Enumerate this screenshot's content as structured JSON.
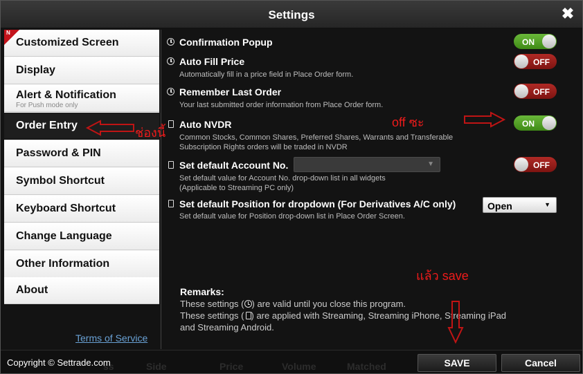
{
  "window": {
    "title": "Settings",
    "close_glyph": "✖"
  },
  "sidebar": {
    "items": [
      {
        "label": "Customized Screen",
        "badge": "N"
      },
      {
        "label": "Display"
      },
      {
        "label": "Alert & Notification",
        "sub": "For Push mode only"
      },
      {
        "label": "Order Entry",
        "active": true
      },
      {
        "label": "Password & PIN"
      },
      {
        "label": "Symbol Shortcut"
      },
      {
        "label": "Keyboard Shortcut"
      },
      {
        "label": "Change Language"
      },
      {
        "label": "Other Information"
      },
      {
        "label": "About"
      }
    ],
    "terms_link": "Terms of Service"
  },
  "settings": [
    {
      "icon": "clock-icon",
      "name": "Confirmation Popup",
      "desc": "",
      "toggle": "ON"
    },
    {
      "icon": "clock-icon",
      "name": "Auto Fill Price",
      "desc": "Automatically fill in a price field in Place Order form.",
      "toggle": "OFF"
    },
    {
      "icon": "clock-icon",
      "name": "Remember Last Order",
      "desc": "Your last submitted order information from Place Order form.",
      "toggle": "OFF"
    },
    {
      "icon": "phone-icon",
      "name": "Auto NVDR",
      "desc": "Common Stocks, Common Shares, Preferred Shares, Warrants and Transferable",
      "desc2": "Subscription Rights orders will be traded in NVDR",
      "toggle": "ON"
    },
    {
      "icon": "phone-icon",
      "name": "Set default Account No.",
      "desc": "Set default value for Account No. drop-down list in all widgets",
      "desc2": "(Applicable to Streaming PC only)",
      "toggle": "OFF",
      "select_value": ""
    },
    {
      "icon": "phone-icon",
      "name": "Set default Position for dropdown (For Derivatives A/C only)",
      "desc": "Set default value for Position drop-down list in Place Order Screen.",
      "select_value": "Open"
    }
  ],
  "remarks": {
    "title": "Remarks:",
    "line1_pre": "These settings (",
    "line1_post": ") are valid until you close this program.",
    "line2_pre": "These settings (",
    "line2_post": ") are applied with Streaming, Streaming iPhone, Streaming iPad",
    "line3": "and Streaming Android."
  },
  "annotations": {
    "sidebar_note": "ช่องนี้",
    "toggle_note": "off ซะ",
    "save_note": "แล้ว   save"
  },
  "footer": {
    "copyright": "Copyright ©  Settrade.com",
    "save_label": "SAVE",
    "cancel_label": "Cancel",
    "ghost_columns": [
      "ss",
      "Side",
      "Price",
      "Volume",
      "Matched"
    ]
  },
  "colors": {
    "on": "#4f9d22",
    "off": "#9a1f1b",
    "annotation": "#ee1b1b",
    "link": "#6aa2d6"
  }
}
